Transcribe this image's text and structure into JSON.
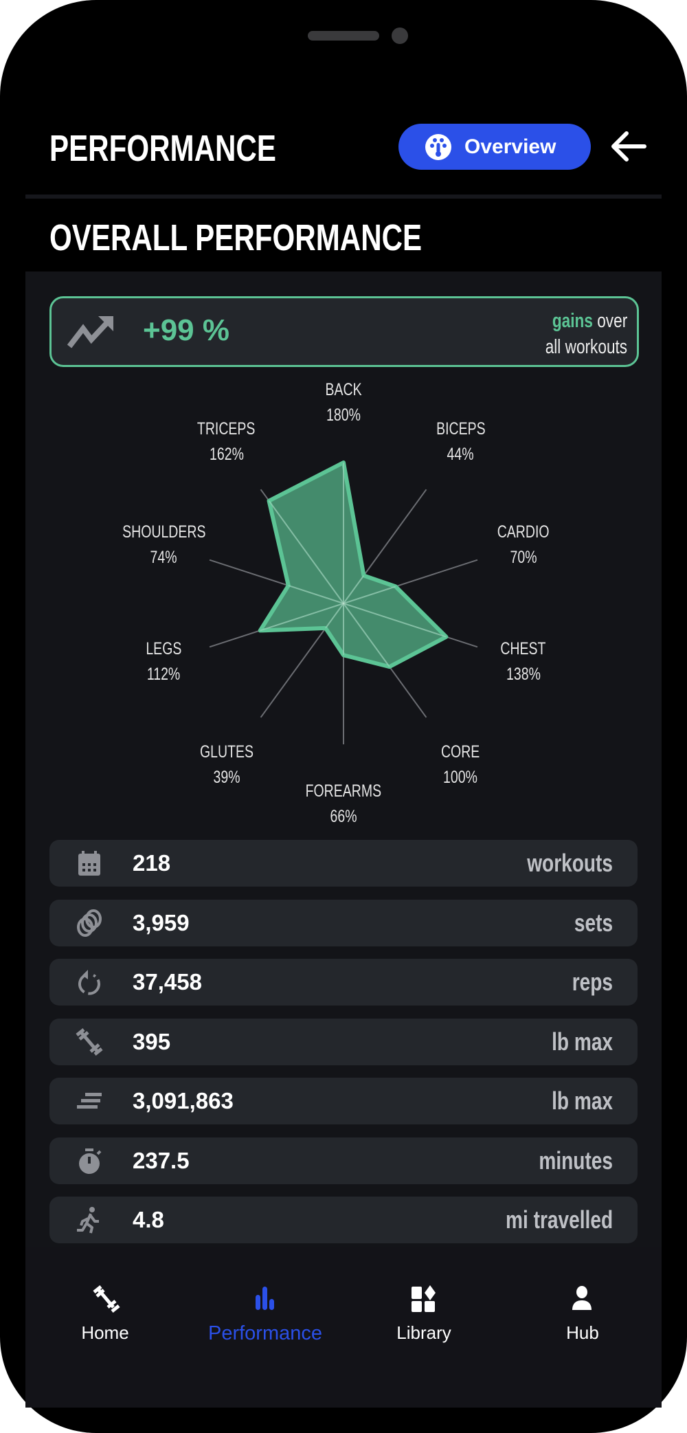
{
  "header": {
    "title": "PERFORMANCE",
    "overview_label": "Overview",
    "overview_icon": "dashboard-gauge-icon",
    "back_icon": "arrow-left-icon"
  },
  "section_title": "OVERALL PERFORMANCE",
  "gains": {
    "value": "+99 %",
    "highlight": "gains",
    "line1_rest": " over",
    "line2": "all workouts",
    "icon": "trending-up-icon"
  },
  "colors": {
    "accent": "#2b50e8",
    "green": "#5cc495",
    "panel": "#131418",
    "card": "#24272c"
  },
  "chart_data": {
    "type": "radar",
    "categories": [
      "BACK",
      "BICEPS",
      "CARDIO",
      "CHEST",
      "CORE",
      "FOREARMS",
      "GLUTES",
      "LEGS",
      "SHOULDERS",
      "TRICEPS"
    ],
    "values": [
      180,
      44,
      70,
      138,
      100,
      66,
      39,
      112,
      74,
      162
    ],
    "labels": [
      "180%",
      "44%",
      "70%",
      "138%",
      "100%",
      "66%",
      "39%",
      "112%",
      "74%",
      "162%"
    ],
    "rmax": 180
  },
  "stats": [
    {
      "icon": "calendar-icon",
      "value": "218",
      "unit": "workouts"
    },
    {
      "icon": "rings-icon",
      "value": "3,959",
      "unit": "sets"
    },
    {
      "icon": "repeat-icon",
      "value": "37,458",
      "unit": "reps"
    },
    {
      "icon": "barbell-icon",
      "value": "395",
      "unit": "lb max"
    },
    {
      "icon": "volume-lines-icon",
      "value": "3,091,863",
      "unit": "lb max"
    },
    {
      "icon": "stopwatch-icon",
      "value": "237.5",
      "unit": "minutes"
    },
    {
      "icon": "running-icon",
      "value": "4.8",
      "unit": "mi travelled"
    }
  ],
  "nav": [
    {
      "label": "Home",
      "icon": "barbell-icon",
      "active": false
    },
    {
      "label": "Performance",
      "icon": "bar-chart-icon",
      "active": true
    },
    {
      "label": "Library",
      "icon": "library-shapes-icon",
      "active": false
    },
    {
      "label": "Hub",
      "icon": "person-icon",
      "active": false
    }
  ]
}
